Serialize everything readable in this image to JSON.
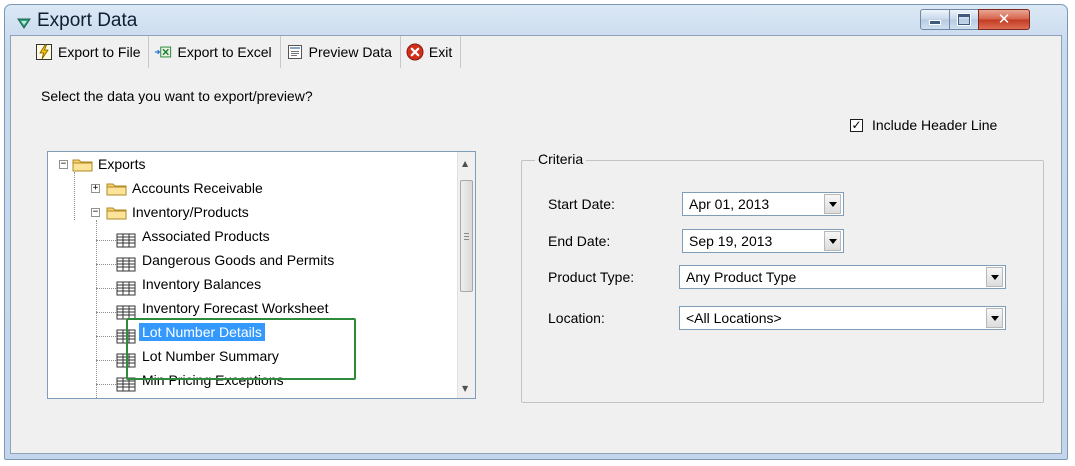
{
  "window": {
    "title": "Export Data",
    "controls": {
      "minimize": "minimize-icon",
      "maximize": "maximize-icon",
      "close": "close-icon"
    }
  },
  "toolbar": {
    "export_file": {
      "label": "Export to File",
      "icon": "lightning-page-icon"
    },
    "export_excel": {
      "label": "Export to Excel",
      "icon": "excel-export-icon"
    },
    "preview": {
      "label": "Preview Data",
      "icon": "preview-document-icon"
    },
    "exit": {
      "label": "Exit",
      "icon": "red-x-circle-icon"
    }
  },
  "prompt": "Select the data you want to export/preview?",
  "include_header": {
    "label": "Include Header Line",
    "checked": true,
    "mark": "✓"
  },
  "tree": {
    "root": {
      "label": "Exports",
      "expander": "−"
    },
    "accounts_receivable": {
      "label": "Accounts Receivable",
      "expander": "+"
    },
    "inventory": {
      "label": "Inventory/Products",
      "expander": "−",
      "children": [
        "Associated Products",
        "Dangerous Goods and Permits",
        "Inventory Balances",
        "Inventory Forecast Worksheet",
        "Lot Number Details",
        "Lot Number Summary",
        "Min Pricing Exceptions"
      ],
      "selected_index": 4
    }
  },
  "criteria": {
    "legend": "Criteria",
    "start_date": {
      "label": "Start Date:",
      "value": "Apr 01, 2013"
    },
    "end_date": {
      "label": "End Date:",
      "value": "Sep 19, 2013"
    },
    "product_type": {
      "label": "Product Type:",
      "value": "Any Product Type"
    },
    "location": {
      "label": "Location:",
      "value": "<All Locations>"
    }
  },
  "colors": {
    "selection": "#3399ff",
    "highlight_box": "#2e8b3a",
    "title_bar": "#c8daee"
  }
}
